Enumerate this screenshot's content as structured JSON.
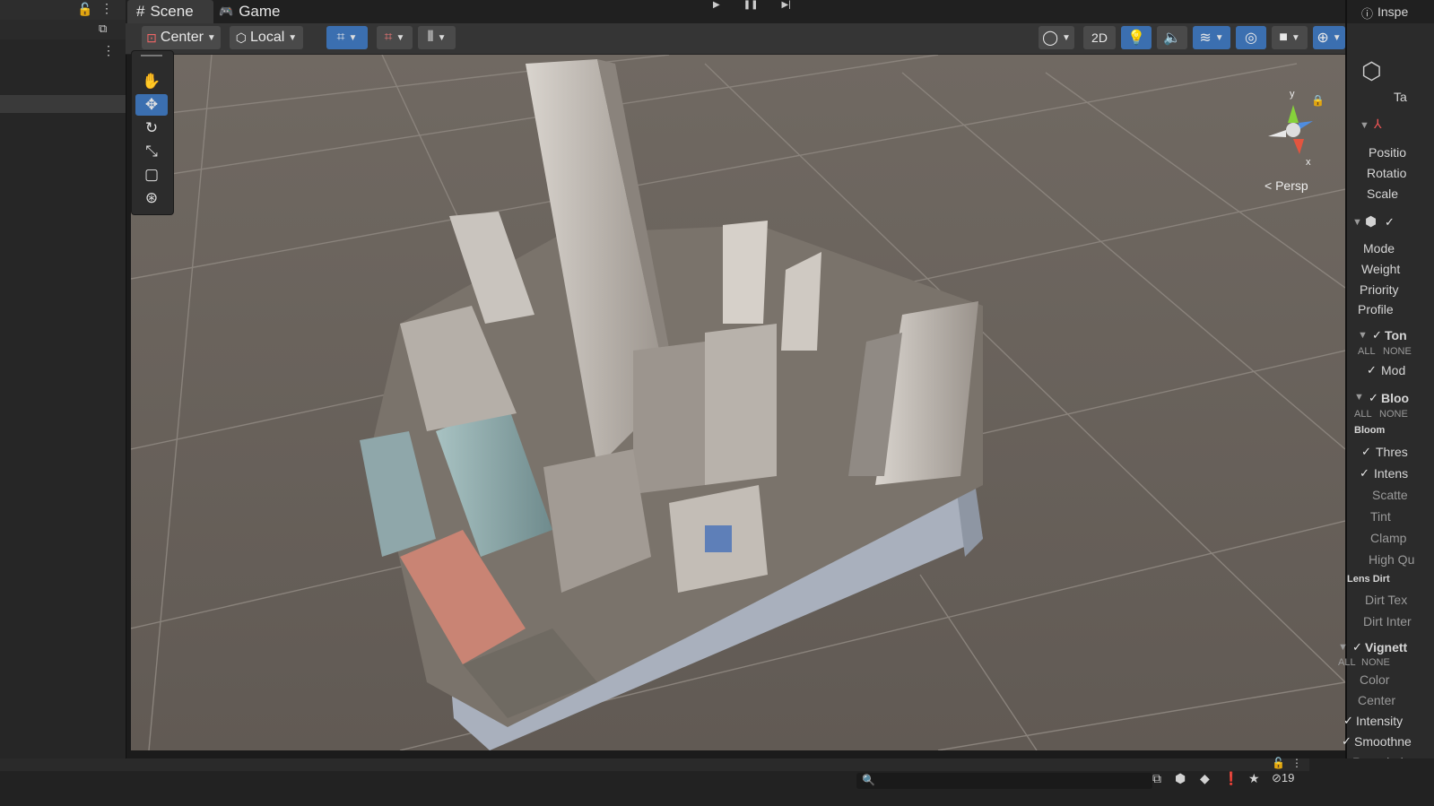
{
  "tabs": [
    {
      "label": "Scene",
      "icon": "hash-icon"
    },
    {
      "label": "Game",
      "icon": "gamepad-icon"
    }
  ],
  "toolbar": {
    "pivot_mode": "Center",
    "pivot_rotation": "Local",
    "view_2d": "2D"
  },
  "viewport": {
    "camera_mode": "Persp",
    "gizmo_y": "y",
    "gizmo_x": "x"
  },
  "inspector": {
    "title": "Inspe",
    "tag_label": "Ta",
    "transform": [
      "Positio",
      "Rotatio",
      "Scale"
    ],
    "volume": [
      "Mode",
      "Weight",
      "Priority",
      "Profile"
    ],
    "tonemapping": {
      "title": "Ton",
      "all": "ALL",
      "none": "NONE",
      "mode": "Mod"
    },
    "bloom": {
      "title": "Bloo",
      "all": "ALL",
      "none": "NONE",
      "section": "Bloom",
      "items": [
        "Thres",
        "Intens",
        "Scatte",
        "Tint",
        "Clamp",
        "High Qu"
      ]
    },
    "lens_dirt": {
      "section": "Lens Dirt",
      "items": [
        "Dirt Tex",
        "Dirt Inter"
      ]
    },
    "vignette": {
      "title": "Vignett",
      "all": "ALL",
      "none": "NONE",
      "items": [
        "Color",
        "Center",
        "Intensity",
        "Smoothne",
        "Rounded"
      ]
    }
  },
  "status": {
    "hidden_count": "19"
  },
  "colors": {
    "accent": "#3b6fb0",
    "viewport_bg": "#6b645e",
    "panel": "#2b2b2b"
  }
}
